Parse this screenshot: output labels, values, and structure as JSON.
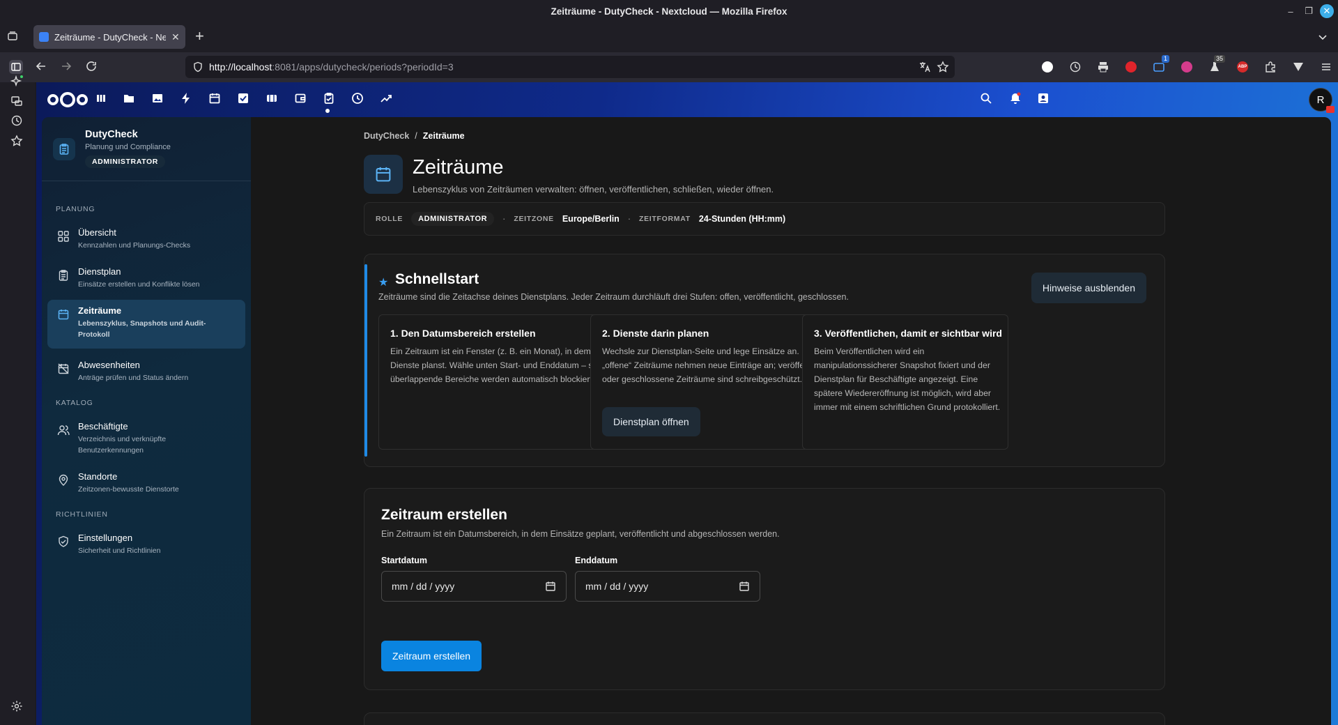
{
  "window": {
    "title": "Zeiträume - DutyCheck - Nextcloud — Mozilla Firefox"
  },
  "browser": {
    "tab_title": "Zeiträume - DutyCheck - Ne",
    "url_host": "http://localhost",
    "url_rest": ":8081/apps/dutycheck/periods?periodId=3",
    "ext_badge_1": "1",
    "ext_badge_2": "35",
    "ext_abp": "ABP"
  },
  "nc_header": {
    "avatar_letter": "R"
  },
  "sidebar": {
    "title": "DutyCheck",
    "subtitle": "Planung und Compliance",
    "role_badge": "ADMINISTRATOR",
    "sections": {
      "planning": "PLANUNG",
      "catalog": "KATALOG",
      "policies": "RICHTLINIEN"
    },
    "items": [
      {
        "label": "Übersicht",
        "sub": "Kennzahlen und Planungs-Checks"
      },
      {
        "label": "Dienstplan",
        "sub": "Einsätze erstellen und Konflikte lösen"
      },
      {
        "label": "Zeiträume",
        "sub": "Lebenszyklus, Snapshots und Audit-Protokoll"
      },
      {
        "label": "Abwesenheiten",
        "sub": "Anträge prüfen und Status ändern"
      },
      {
        "label": "Beschäftigte",
        "sub": "Verzeichnis und verknüpfte Benutzerkennungen"
      },
      {
        "label": "Standorte",
        "sub": "Zeitzonen-bewusste Dienstorte"
      },
      {
        "label": "Einstellungen",
        "sub": "Sicherheit und Richtlinien"
      }
    ]
  },
  "breadcrumb": {
    "root": "DutyCheck",
    "sep": "/",
    "current": "Zeiträume"
  },
  "page": {
    "title": "Zeiträume",
    "subtitle": "Lebenszyklus von Zeiträumen verwalten: öffnen, veröffentlichen, schließen, wieder öffnen."
  },
  "meta": {
    "role_label": "ROLLE",
    "role_value": "ADMINISTRATOR",
    "dot": "·",
    "tz_label": "ZEITZONE",
    "tz_value": "Europe/Berlin",
    "fmt_label": "ZEITFORMAT",
    "fmt_value": "24-Stunden (HH:mm)"
  },
  "quickstart": {
    "star": "★",
    "title": "Schnellstart",
    "subtitle": "Zeiträume sind die Zeitachse deines Dienstplans. Jeder Zeitraum durchläuft drei Stufen: offen, veröffentlicht, geschlossen.",
    "hide_button": "Hinweise ausblenden",
    "steps": [
      {
        "title": "1. Den Datumsbereich erstellen",
        "body": "Ein Zeitraum ist ein Fenster (z. B. ein Monat), in dem du Dienste planst. Wähle unten Start- und Enddatum – sich überlappende Bereiche werden automatisch blockiert."
      },
      {
        "title": "2. Dienste darin planen",
        "body": "Wechsle zur Dienstplan-Seite und lege Einsätze an. Nur „offene“ Zeiträume nehmen neue Einträge an; veröffentlichte oder geschlossene Zeiträume sind schreibgeschützt.",
        "button": "Dienstplan öffnen"
      },
      {
        "title": "3. Veröffentlichen, damit er sichtbar wird",
        "body": "Beim Veröffentlichen wird ein manipulationssicherer Snapshot fixiert und der Dienstplan für Beschäftigte angezeigt. Eine spätere Wiedereröffnung ist möglich, wird aber immer mit einem schriftlichen Grund protokolliert."
      }
    ]
  },
  "create": {
    "title": "Zeitraum erstellen",
    "subtitle": "Ein Zeitraum ist ein Datumsbereich, in dem Einsätze geplant, veröffentlicht und abgeschlossen werden.",
    "start_label": "Startdatum",
    "end_label": "Enddatum",
    "date_placeholder": "mm / dd / yyyy",
    "submit": "Zeitraum erstellen"
  },
  "colors": {
    "accent": "#0a84e0",
    "active_nav": "#1a3f5c",
    "icon_blue": "#5bb3f5"
  }
}
